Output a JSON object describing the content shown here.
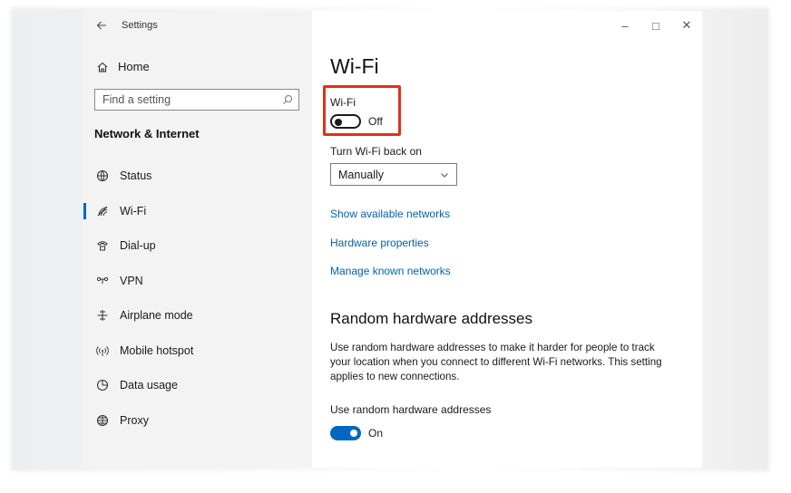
{
  "titlebar": {
    "app_title": "Settings",
    "back_icon": "arrow-left-icon",
    "minimize": "–",
    "maximize": "□",
    "close": "✕"
  },
  "sidebar": {
    "home_label": "Home",
    "search_placeholder": "Find a setting",
    "section_heading": "Network & Internet",
    "items": [
      {
        "label": "Status",
        "icon": "globe-icon",
        "active": false
      },
      {
        "label": "Wi-Fi",
        "icon": "wifi-icon",
        "active": true
      },
      {
        "label": "Dial-up",
        "icon": "phone-icon",
        "active": false
      },
      {
        "label": "VPN",
        "icon": "vpn-icon",
        "active": false
      },
      {
        "label": "Airplane mode",
        "icon": "airplane-icon",
        "active": false
      },
      {
        "label": "Mobile hotspot",
        "icon": "hotspot-icon",
        "active": false
      },
      {
        "label": "Data usage",
        "icon": "data-usage-icon",
        "active": false
      },
      {
        "label": "Proxy",
        "icon": "proxy-globe-icon",
        "active": false
      }
    ]
  },
  "main": {
    "title": "Wi-Fi",
    "wifi_toggle": {
      "label": "Wi-Fi",
      "state": "Off"
    },
    "turn_back_on": {
      "label": "Turn Wi-Fi back on",
      "selected": "Manually"
    },
    "links": [
      "Show available networks",
      "Hardware properties",
      "Manage known networks"
    ],
    "random_heading": "Random hardware addresses",
    "random_description": "Use random hardware addresses to make it harder for people to track your location when you connect to different Wi-Fi networks. This setting applies to new connections.",
    "random_toggle": {
      "label": "Use random hardware addresses",
      "state": "On"
    }
  },
  "colors": {
    "accent": "#0067c0",
    "link": "#0063b1",
    "highlight_border": "#e0301e",
    "sidebar_bg": "#f3f3f3"
  }
}
